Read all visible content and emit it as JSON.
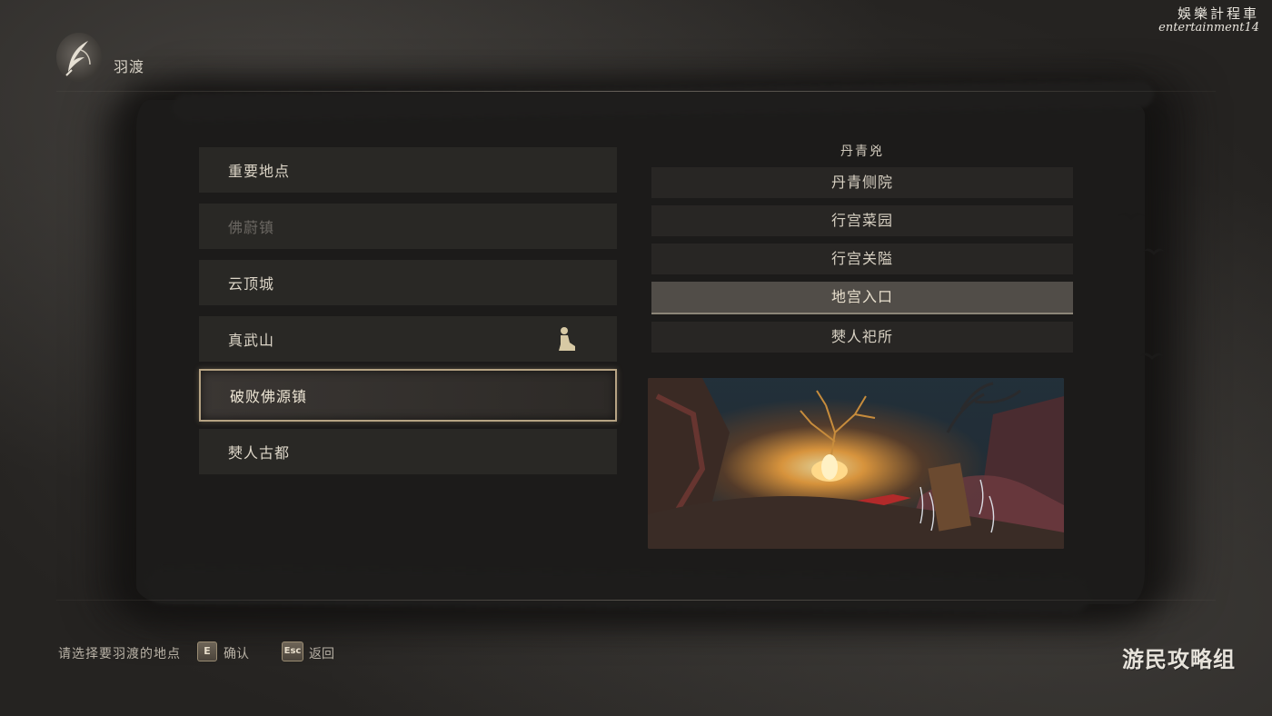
{
  "header": {
    "title": "羽渡"
  },
  "watermark": {
    "cn": "娛樂計程車",
    "en": "entertainment14"
  },
  "regions": [
    {
      "label": "重要地点",
      "state": "normal"
    },
    {
      "label": "佛蔚镇",
      "state": "disabled"
    },
    {
      "label": "云顶城",
      "state": "normal"
    },
    {
      "label": "真武山",
      "state": "normal",
      "icon": "kneeling-figure-icon"
    },
    {
      "label": "破败佛源镇",
      "state": "selected"
    },
    {
      "label": "僰人古都",
      "state": "normal"
    }
  ],
  "sites": {
    "header": "丹青兇",
    "items": [
      {
        "label": "丹青侧院"
      },
      {
        "label": "行宫菜园"
      },
      {
        "label": "行宫关隘"
      },
      {
        "label": "地宫入口",
        "active": true
      },
      {
        "label": "僰人祀所"
      }
    ]
  },
  "footer": {
    "hint": "请选择要羽渡的地点",
    "confirm_key": "E",
    "confirm_label": "确认",
    "back_key": "Esc",
    "back_label": "返回"
  },
  "logo": {
    "text": "游民攻略组"
  }
}
